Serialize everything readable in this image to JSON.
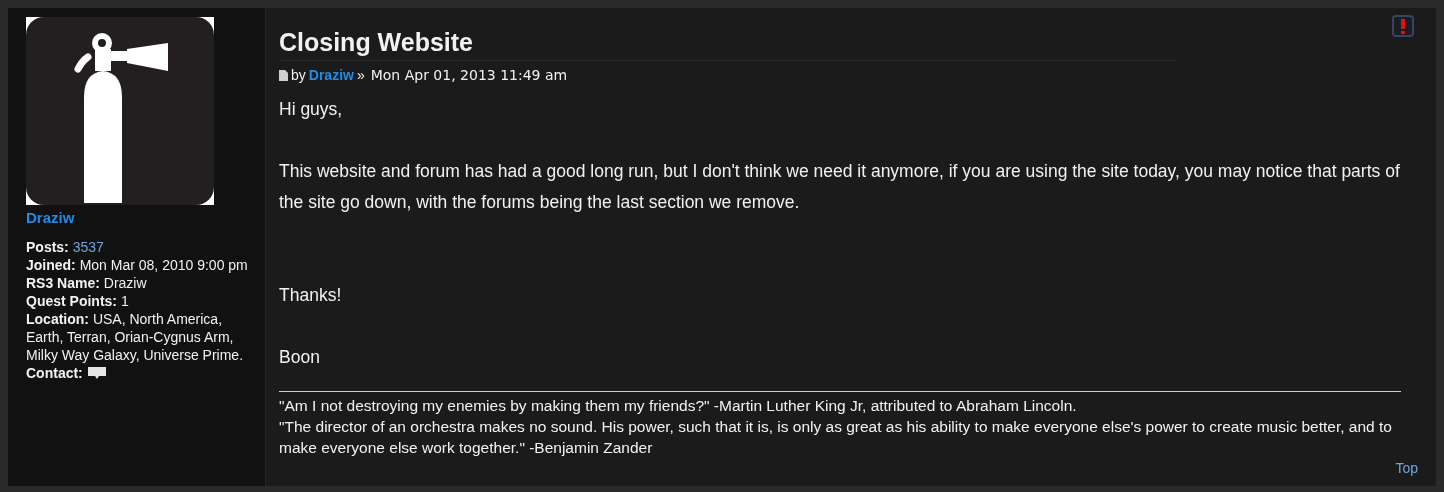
{
  "profile": {
    "username": "Draziw",
    "fields": [
      {
        "label": "Posts:",
        "value": "3537",
        "kind": "link"
      },
      {
        "label": "Joined:",
        "value": "Mon Mar 08, 2010 9:00 pm",
        "kind": "text"
      },
      {
        "label": "RS3 Name:",
        "value": "Draziw",
        "kind": "text"
      },
      {
        "label": "Quest Points:",
        "value": "1",
        "kind": "text"
      },
      {
        "label": "Location:",
        "value": "USA, North America, Earth, Terran, Orian-Cygnus Arm, Milky Way Galaxy, Universe Prime.",
        "kind": "text"
      }
    ],
    "contact_label": "Contact:"
  },
  "post": {
    "title": "Closing Website",
    "by": "by",
    "author": "Draziw",
    "separator": "»",
    "date": "Mon Apr 01, 2013 11:49 am",
    "body": [
      "Hi guys,",
      "This website and forum has had a good long run, but I don't think we need it anymore, if you are using the site today, you may notice that parts of the site go down, with the forums being the last section we remove.",
      "Thanks!",
      "Boon"
    ],
    "signature": [
      "\"Am I not destroying my enemies by making them my friends?\" -Martin Luther King Jr, attributed to Abraham Lincoln.",
      "\"The director of an orchestra makes no sound. His power, such that it is, is only as great as his ability to make everyone else's power to create music better, and to make everyone else work together.\" -Benjamin Zander"
    ],
    "top_link": "Top"
  }
}
